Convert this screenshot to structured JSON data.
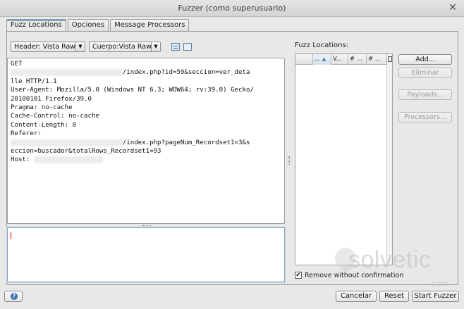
{
  "window": {
    "title": "Fuzzer (como superusuario)"
  },
  "tabs": [
    {
      "label": "Fuzz Locations",
      "active": true
    },
    {
      "label": "Opciones",
      "active": false
    },
    {
      "label": "Message Processors",
      "active": false
    }
  ],
  "left": {
    "header_combo": "Header: Vista Raw",
    "body_combo": "Cuerpo:Vista Raw",
    "view_icons": [
      "split-view-icon",
      "single-view-icon"
    ],
    "request_lines": [
      {
        "text": "GET"
      },
      {
        "blurred": "http://blurredhostname.com.ar",
        "text": "/index.php?id=59&seccion=ver_deta"
      },
      {
        "text": "lle HTTP/1.1"
      },
      {
        "text": "User-Agent: Mozilla/5.0 (Windows NT 6.3; WOW64; rv:39.0) Gecko/"
      },
      {
        "text": "20100101 Firefox/39.0"
      },
      {
        "text": "Pragma: no-cache"
      },
      {
        "text": "Cache-Control: no-cache"
      },
      {
        "text": "Content-Length: 0"
      },
      {
        "text": "Referer:"
      },
      {
        "blurred": "http://blurredhostname.com.ar",
        "text": "/index.php?pageNum_Recordset1=3&s"
      },
      {
        "text": "eccion=buscador&totalRows_Recordset1=93"
      },
      {
        "prefix": "Host: ",
        "blurred": "blurredhost.com.ar",
        "text": ""
      }
    ]
  },
  "right": {
    "label": "Fuzz Locations:",
    "columns": [
      "...",
      "V...",
      "# ...",
      "# ..."
    ],
    "buttons": [
      {
        "label": "Add...",
        "enabled": true
      },
      {
        "label": "Eliminar",
        "enabled": false
      },
      {
        "label": "Payloads...",
        "enabled": false
      },
      {
        "label": "Processors...",
        "enabled": false
      }
    ],
    "checkbox": {
      "label": "Remove without confirmation",
      "checked": true
    }
  },
  "watermark": {
    "text": "solvetic",
    "sub": ".com"
  },
  "footer": {
    "help_icon": "help-icon",
    "cancel": "Cancelar",
    "reset": "Reset",
    "start": "Start Fuzzer"
  }
}
